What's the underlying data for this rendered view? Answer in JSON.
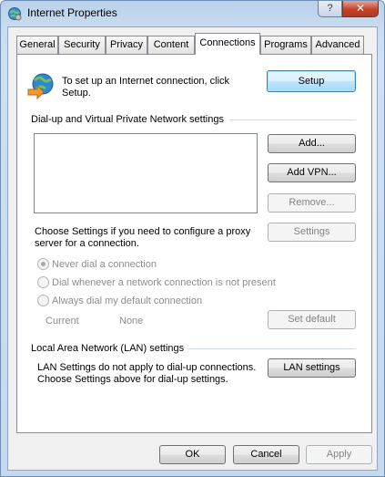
{
  "window": {
    "title": "Internet Properties",
    "help_label": "?",
    "close_label": "✕"
  },
  "tabs": [
    {
      "label": "General"
    },
    {
      "label": "Security"
    },
    {
      "label": "Privacy"
    },
    {
      "label": "Content"
    },
    {
      "label": "Connections",
      "active": true
    },
    {
      "label": "Programs"
    },
    {
      "label": "Advanced"
    }
  ],
  "setup": {
    "text_line1": "To set up an Internet connection, click",
    "text_line2": "Setup.",
    "button": "Setup"
  },
  "dialup": {
    "group_label": "Dial-up and Virtual Private Network settings",
    "add_button": "Add...",
    "add_vpn_button": "Add VPN...",
    "remove_button": "Remove...",
    "proxy_text_line1": "Choose Settings if you need to configure a proxy",
    "proxy_text_line2": "server for a connection.",
    "settings_button": "Settings",
    "radio_never": "Never dial a connection",
    "radio_whenever": "Dial whenever a network connection is not present",
    "radio_always": "Always dial my default connection",
    "current_label": "Current",
    "current_value": "None",
    "set_default_button": "Set default"
  },
  "lan": {
    "group_label": "Local Area Network (LAN) settings",
    "text_line1": "LAN Settings do not apply to dial-up connections.",
    "text_line2": "Choose Settings above for dial-up settings.",
    "button": "LAN settings"
  },
  "footer": {
    "ok": "OK",
    "cancel": "Cancel",
    "apply": "Apply"
  },
  "icons": {
    "app": "globe-gear-icon",
    "connect": "globe-arrow-icon"
  }
}
